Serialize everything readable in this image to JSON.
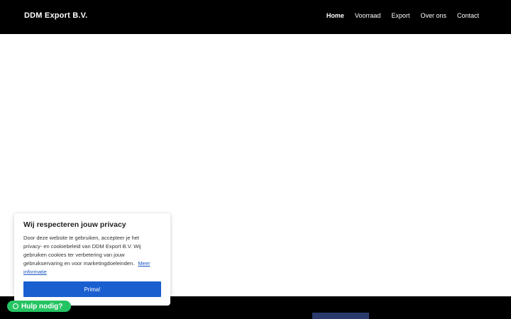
{
  "header": {
    "brand": "DDM Export B.V.",
    "nav": [
      {
        "label": "Home",
        "active": true
      },
      {
        "label": "Voorraad"
      },
      {
        "label": "Export"
      },
      {
        "label": "Over ons"
      },
      {
        "label": "Contact"
      }
    ]
  },
  "cookie_banner": {
    "title": "Wij respecteren jouw privacy",
    "body": "Door deze website te gebruiken, accepteer je het privacy- en cookiebeleid van DDM Export B.V. Wij gebruiken cookies ter verbetering van jouw gebruikservaring en voor marketingdoeleinden.",
    "link": "Meer informatie",
    "button": "Prima!"
  },
  "help_button": {
    "label": "Hulp nodig?",
    "icon": "whatsapp-icon"
  },
  "colors": {
    "header_bg": "#000000",
    "primary_button": "#1a5fd0",
    "help_green": "#25c463"
  }
}
